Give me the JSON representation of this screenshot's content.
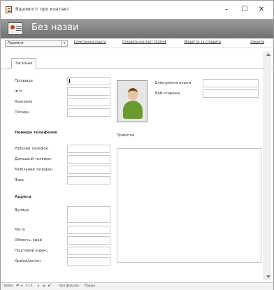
{
  "window": {
    "title": "Відомості про контакт",
    "minimize": "–",
    "maximize": "☐",
    "close": "✕"
  },
  "header": {
    "title": "Без назви"
  },
  "toolbar": {
    "go_to_value": "Перейти",
    "go_to_dropdown": "▾",
    "links": [
      "Електронна пошта",
      "Створити контакт Outlook",
      "Зберегти та створити",
      "Закрити"
    ]
  },
  "tabs": [
    "Загальне"
  ],
  "form": {
    "labels": {
      "last_name": "Прізвище",
      "first_name": "Ім'я",
      "company": "Компанія",
      "job_title": "Посада",
      "email": "Електронна пошта",
      "web_page": "Веб-сторінка",
      "notes": "Примітки",
      "work_phone": "Робочий телефон",
      "home_phone": "Домашній телефон",
      "mobile_phone": "Мобільний телефон",
      "fax": "Факс",
      "street": "Вулиця",
      "city": "Місто",
      "region": "Область, край",
      "postal_code": "Поштовий індекс",
      "country": "Країна/регіон"
    },
    "sections": {
      "phones": "Номери телефонів",
      "address": "Адреса"
    }
  },
  "statusbar": {
    "record_label": "Запис:",
    "nav_first": "⏮",
    "nav_prev": "◂",
    "record_position": "1 з 1",
    "nav_next": "▸",
    "nav_last": "⏭",
    "nav_new": "▸*",
    "filter": "Без фільтра",
    "search": "Пошук"
  }
}
